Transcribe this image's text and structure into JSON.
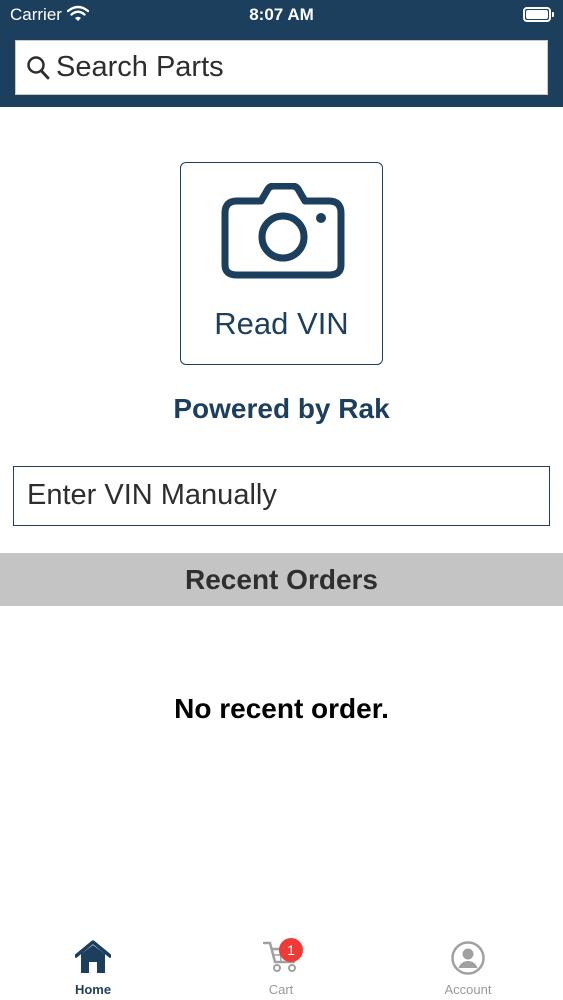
{
  "status_bar": {
    "carrier": "Carrier",
    "time": "8:07 AM",
    "icons": [
      "wifi-icon",
      "battery-icon"
    ]
  },
  "search": {
    "placeholder": "Search Parts",
    "icon": "search-icon"
  },
  "read_vin": {
    "label": "Read VIN",
    "icon": "camera-icon"
  },
  "powered_by": "Powered by Rak",
  "vin_input": {
    "placeholder": "Enter VIN Manually",
    "value": ""
  },
  "recent_orders": {
    "title": "Recent Orders",
    "empty_message": "No recent order."
  },
  "tab_bar": {
    "tabs": [
      {
        "label": "Home",
        "icon": "home-icon",
        "active": true
      },
      {
        "label": "Cart",
        "icon": "cart-icon",
        "active": false,
        "badge": "1"
      },
      {
        "label": "Account",
        "icon": "account-icon",
        "active": false
      }
    ]
  },
  "colors": {
    "primary": "#1c3f5e",
    "section_header_bg": "#c4c4c4",
    "badge": "#f03a36",
    "inactive_tab": "#9a9a9a"
  }
}
